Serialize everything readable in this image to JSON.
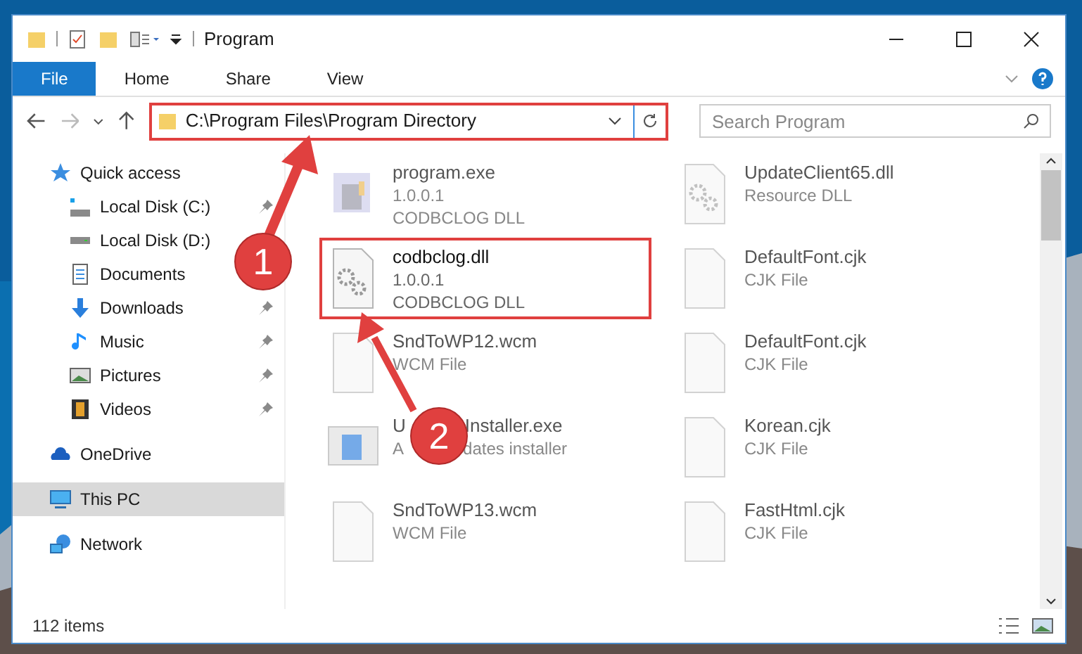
{
  "window": {
    "title": "Program"
  },
  "ribbon_tabs": [
    {
      "label": "File",
      "selected": true
    },
    {
      "label": "Home",
      "selected": false
    },
    {
      "label": "Share",
      "selected": false
    },
    {
      "label": "View",
      "selected": false
    }
  ],
  "address": {
    "path": "C:\\Program Files\\Program Directory",
    "highlighted": true
  },
  "search": {
    "placeholder": "Search Program"
  },
  "sidebar": {
    "items": [
      {
        "label": "Quick access",
        "kind": "star",
        "selected": false,
        "children": [
          {
            "label": "Local Disk (C:)",
            "kind": "system-drive",
            "pinned": true,
            "selected": false
          },
          {
            "label": "Local Disk (D:)",
            "kind": "drive",
            "pinned": false,
            "selected": false
          },
          {
            "label": "Documents",
            "kind": "documents",
            "pinned": false,
            "selected": false
          },
          {
            "label": "Downloads",
            "kind": "downloads",
            "pinned": true,
            "selected": false
          },
          {
            "label": "Music",
            "kind": "music",
            "pinned": true,
            "selected": false
          },
          {
            "label": "Pictures",
            "kind": "pictures",
            "pinned": true,
            "selected": false
          },
          {
            "label": "Videos",
            "kind": "videos",
            "pinned": true,
            "selected": false
          }
        ]
      },
      {
        "label": "OneDrive",
        "kind": "cloud",
        "selected": false
      },
      {
        "label": "This PC",
        "kind": "pc",
        "selected": true
      },
      {
        "label": "Network",
        "kind": "network",
        "selected": false
      }
    ]
  },
  "files": [
    {
      "kind": "exe",
      "name": [
        "program.exe"
      ],
      "details": [
        [
          "1.0.0.1"
        ],
        [
          "CODBCLOG DLL"
        ]
      ],
      "blurred": true,
      "highlighted": false
    },
    {
      "kind": "dll",
      "name": [
        "UpdateClient65.dll"
      ],
      "details": [
        [
          "Resource DLL"
        ]
      ],
      "blurred": true,
      "highlighted": false
    },
    {
      "kind": "dll",
      "name": [
        "codbclog.dll"
      ],
      "details": [
        [
          "1.0.0.1"
        ],
        [
          "CODBCLOG DLL"
        ]
      ],
      "blurred": false,
      "highlighted": true
    },
    {
      "kind": "file",
      "name": [
        "DefaultFont.cjk"
      ],
      "details": [
        [
          "CJK File"
        ]
      ],
      "blurred": true,
      "highlighted": false
    },
    {
      "kind": "file",
      "name": [
        "SndToWP12.wcm"
      ],
      "details": [
        [
          "WCM File"
        ]
      ],
      "blurred": true,
      "highlighted": false
    },
    {
      "kind": "file",
      "name": [
        "DefaultFont.cjk"
      ],
      "details": [
        [
          "CJK File"
        ]
      ],
      "blurred": true,
      "highlighted": false
    },
    {
      "kind": "installer",
      "name": [
        "U",
        "Installer.exe"
      ],
      "details": [
        [
          "A",
          "dates installer"
        ]
      ],
      "blurred": true,
      "highlighted": false
    },
    {
      "kind": "file",
      "name": [
        "Korean.cjk"
      ],
      "details": [
        [
          "CJK File"
        ]
      ],
      "blurred": true,
      "highlighted": false
    },
    {
      "kind": "file",
      "name": [
        "SndToWP13.wcm"
      ],
      "details": [
        [
          "WCM File"
        ]
      ],
      "blurred": true,
      "highlighted": false
    },
    {
      "kind": "file",
      "name": [
        "FastHtml.cjk"
      ],
      "details": [
        [
          "CJK File"
        ]
      ],
      "blurred": true,
      "highlighted": false
    }
  ],
  "status_bar": {
    "items": "112 items"
  },
  "callouts": [
    "1",
    "2"
  ]
}
